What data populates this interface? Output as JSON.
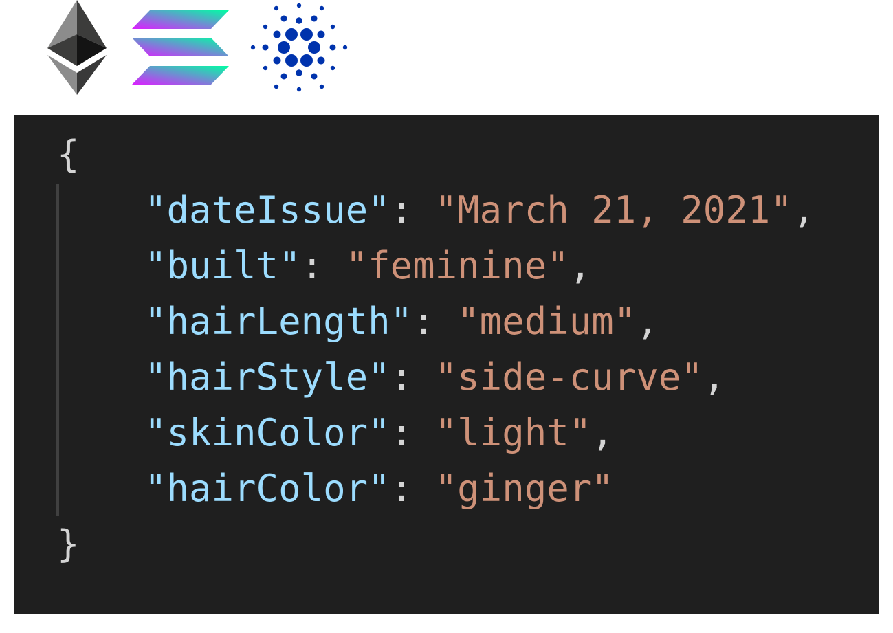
{
  "logos": [
    {
      "name": "ethereum-logo",
      "colors": [
        "#8c8c8c",
        "#343434",
        "#3c3c3b",
        "#141414",
        "#393939"
      ]
    },
    {
      "name": "solana-logo",
      "colors": [
        "#00ffa3",
        "#dc1fff"
      ]
    },
    {
      "name": "cardano-logo",
      "colors": [
        "#0033ad"
      ]
    }
  ],
  "code": {
    "open_brace": "{",
    "close_brace": "}",
    "colon": ": ",
    "comma": ",",
    "entries": [
      {
        "key": "\"dateIssue\"",
        "value": "\"March 21, 2021\""
      },
      {
        "key": "\"built\"",
        "value": "\"feminine\""
      },
      {
        "key": "\"hairLength\"",
        "value": "\"medium\""
      },
      {
        "key": "\"hairStyle\"",
        "value": "\"side-curve\""
      },
      {
        "key": "\"skinColor\"",
        "value": "\"light\""
      },
      {
        "key": "\"hairColor\"",
        "value": "\"ginger\""
      }
    ],
    "colors": {
      "background": "#1f1f1f",
      "key": "#9cdcfe",
      "string": "#ce9178",
      "punctuation": "#d4d4d4",
      "indent_guide": "#404040"
    }
  }
}
